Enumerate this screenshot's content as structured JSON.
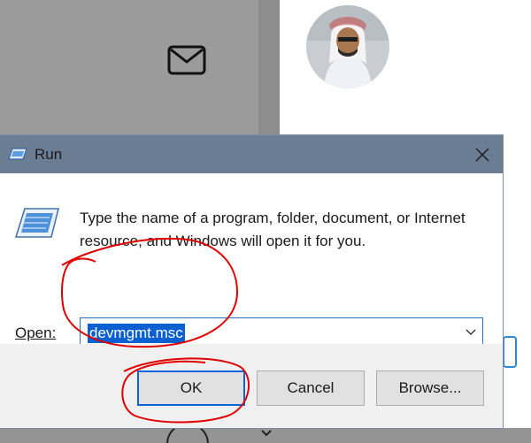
{
  "dialog": {
    "title": "Run",
    "close_icon": "close-icon",
    "run_icon": "run-program-icon",
    "description": "Type the name of a program, folder, document, or Internet resource, and Windows will open it for you.",
    "open_label": "Open:",
    "open_value": "devmgmt.msc",
    "buttons": {
      "ok": "OK",
      "cancel": "Cancel",
      "browse": "Browse..."
    }
  },
  "background": {
    "mail_icon": "mail-icon",
    "avatar": "profile-avatar"
  },
  "colors": {
    "titlebar": "#6b7d93",
    "selection": "#0a5fd1",
    "annotation": "#e00000",
    "button_focus": "#0a66d8"
  }
}
